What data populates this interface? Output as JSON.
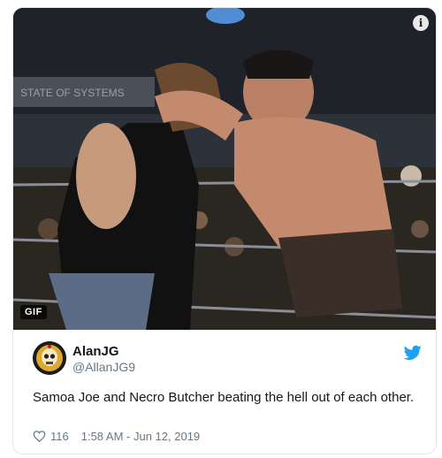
{
  "media": {
    "badge": "GIF",
    "info_icon": "info-icon",
    "banner_text": "STATE OF SYSTEMS"
  },
  "author": {
    "display_name": "AlanJG",
    "handle": "@AllanJG9",
    "avatar_icon": "skull-avatar"
  },
  "tweet": {
    "text": "Samoa Joe and Necro Butcher beating the hell out of each other."
  },
  "meta": {
    "like_icon": "heart-icon",
    "likes": "116",
    "timestamp": "1:58 AM - Jun 12, 2019"
  },
  "colors": {
    "brand": "#1da1f2",
    "secondary_text": "#657786",
    "border": "#e1e8ed"
  }
}
